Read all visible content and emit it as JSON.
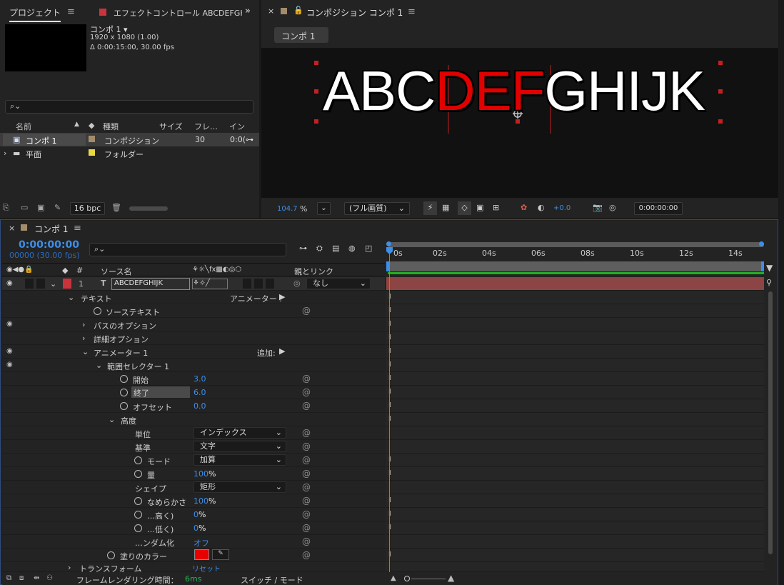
{
  "project": {
    "tab_label": "プロジェクト",
    "effect_tab_label": "エフェクトコントロール ABCDEFGHIJK",
    "comp_name": "コンポ 1 ▾",
    "comp_resolution": "1920 x 1080 (1.00)",
    "comp_duration": "Δ 0:00:15:00, 30.00 fps",
    "search_placeholder": "",
    "columns": {
      "name": "名前",
      "type": "種類",
      "size": "サイズ",
      "frame": "フレ…",
      "in": "インポ…"
    },
    "rows": [
      {
        "name": "コンポ 1",
        "type": "コンポジション",
        "frame": "30",
        "in": "0:0(",
        "color": "#a38c6a",
        "selected": true
      },
      {
        "name": "平面",
        "type": "フォルダー",
        "frame": "",
        "in": "",
        "color": "#e8d843",
        "selected": false
      }
    ],
    "bpc": "16 bpc"
  },
  "viewer": {
    "title": "コンポジション コンポ 1",
    "comp_button": "コンポ 1",
    "text_black": "ABC",
    "text_red": "DEF",
    "text_white": "GHIJK",
    "zoom": "104.7",
    "zoom_unit": "%",
    "quality": "(フル画質)",
    "exposure": "+0.0",
    "timecode": "0:00:00:00"
  },
  "timeline": {
    "tab_label": "コンポ 1",
    "timecode": "0:00:00:00",
    "frames": "00000 (30.00 fps)",
    "col_source": "ソース名",
    "col_parent": "親とリンク",
    "layer_num": "1",
    "layer_name": "ABCDEFGHIJK",
    "parent_value": "なし",
    "ruler": [
      "0s",
      "02s",
      "04s",
      "06s",
      "08s",
      "10s",
      "12s",
      "14s"
    ],
    "props": {
      "text": "テキスト",
      "animator_label": "アニメーター :",
      "source_text": "ソーステキスト",
      "path_options": "パスのオプション",
      "more_options": "詳細オプション",
      "animator1": "アニメーター 1",
      "add_label": "追加:",
      "range_selector": "範囲セレクター 1",
      "start": "開始",
      "start_val": "3.0",
      "end": "終了",
      "end_val": "6.0",
      "offset": "オフセット",
      "offset_val": "0.0",
      "advanced": "高度",
      "units": "単位",
      "units_val": "インデックス",
      "based_on": "基準",
      "based_on_val": "文字",
      "mode": "モード",
      "mode_val": "加算",
      "amount": "量",
      "amount_num": "100",
      "amount_pct": "%",
      "shape": "シェイプ",
      "shape_val": "矩形",
      "smooth": "なめらかさ",
      "smooth_num": "100",
      "smooth_pct": "%",
      "ease_high": "…高く)",
      "ease_high_num": "0",
      "ease_high_pct": "%",
      "ease_low": "…低く)",
      "ease_low_num": "0",
      "ease_low_pct": "%",
      "randomize": "…ンダム化",
      "randomize_val": "オフ",
      "fill_color": "塗りのカラー",
      "transform": "トランスフォーム",
      "reset": "リセット"
    },
    "footer_render": "フレームレンダリング時間：",
    "footer_render_val": "6ms",
    "footer_switch": "スイッチ / モード"
  },
  "colors": {
    "accent_blue": "#3d8ee8",
    "label_red": "#c9343c",
    "fill_red": "#e60000",
    "bar_red": "#a84a4a"
  }
}
